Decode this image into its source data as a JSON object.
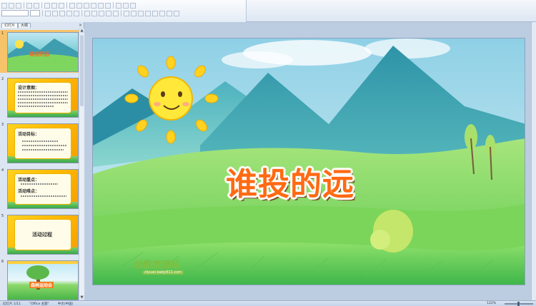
{
  "toolbar": {
    "font_name": "",
    "font_size": "",
    "icons": [
      "bold-icon",
      "italic-icon",
      "underline-icon",
      "strikethrough-icon",
      "align-left-icon",
      "align-center-icon",
      "bullets-icon",
      "numbering-icon",
      "picture-icon",
      "shapes-icon",
      "undo-icon",
      "redo-icon",
      "zoom-icon",
      "help-icon"
    ]
  },
  "panel": {
    "tabs": [
      {
        "label": "幻灯片"
      },
      {
        "label": "大纲"
      }
    ],
    "close_glyph": "×",
    "slides": [
      {
        "number": "1",
        "title": "谁投的远"
      },
      {
        "number": "2",
        "title": "设计意图："
      },
      {
        "number": "3",
        "title": "活动目标："
      },
      {
        "number": "4",
        "title": "活动重点：",
        "subtitle": "活动难点："
      },
      {
        "number": "5",
        "title": "活动过程"
      },
      {
        "number": "6",
        "title": "森林运动会"
      }
    ]
  },
  "slide": {
    "title": "谁投的远",
    "logo": "幼教资源站",
    "logo_url": "ziyuan.baby611.com"
  },
  "statusbar": {
    "slide_info": "幻灯片 1/11",
    "theme": "\"Office 主题\"",
    "language": "中文(中国)",
    "zoom": "122%"
  },
  "colors": {
    "accent": "#ff6a13",
    "selection": "#f7c36a",
    "frame": "#ffc107"
  }
}
